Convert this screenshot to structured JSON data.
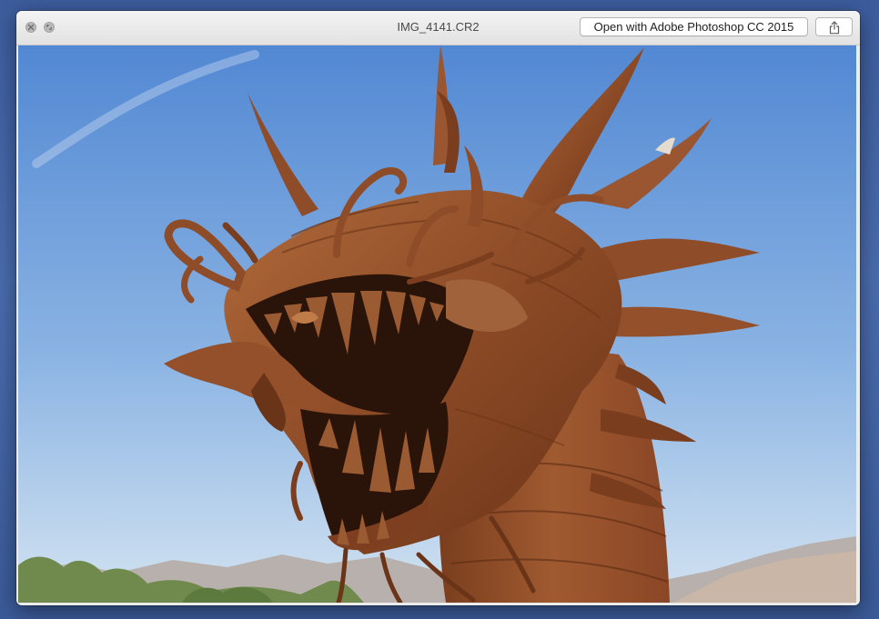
{
  "window": {
    "title": "IMG_4141.CR2",
    "open_with_label": "Open with Adobe Photoshop CC 2015"
  },
  "icons": {
    "close": "close-icon",
    "fullscreen": "fullscreen-icon",
    "share": "share-icon"
  },
  "preview": {
    "colors": {
      "sky_top": "#5b8fd6",
      "sky_bottom": "#c9dcef",
      "rust": "#8a4a26",
      "rust_dark": "#5a2c14",
      "rust_light": "#b8703e",
      "mountains": "#b9b2ae"
    }
  }
}
